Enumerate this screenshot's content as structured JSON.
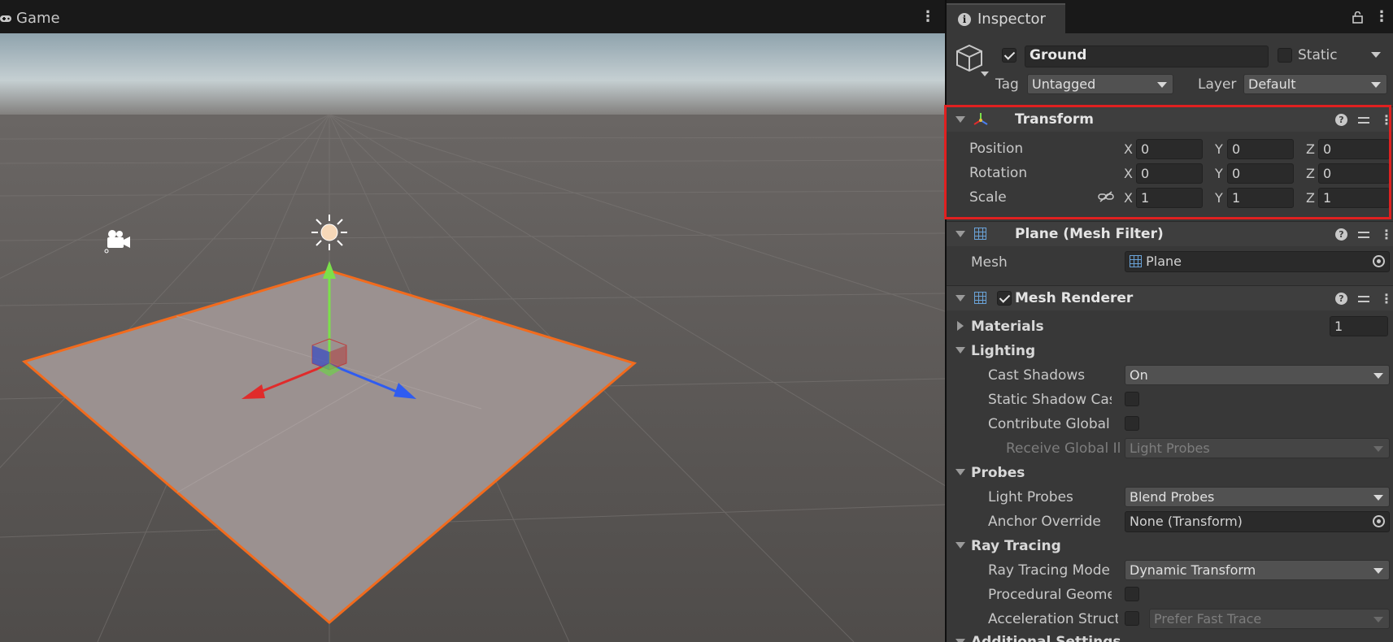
{
  "game": {
    "tab_label": "Game"
  },
  "inspector": {
    "tab_label": "Inspector",
    "object": {
      "active": true,
      "name": "Ground",
      "static_label": "Static",
      "static": false,
      "tag_label": "Tag",
      "tag_value": "Untagged",
      "layer_label": "Layer",
      "layer_value": "Default"
    },
    "transform": {
      "title": "Transform",
      "position_label": "Position",
      "rotation_label": "Rotation",
      "scale_label": "Scale",
      "position": {
        "x": "0",
        "y": "0",
        "z": "0"
      },
      "rotation": {
        "x": "0",
        "y": "0",
        "z": "0"
      },
      "scale": {
        "x": "1",
        "y": "1",
        "z": "1"
      },
      "axes": {
        "x": "X",
        "y": "Y",
        "z": "Z"
      }
    },
    "mesh_filter": {
      "title": "Plane (Mesh Filter)",
      "mesh_label": "Mesh",
      "mesh_value": "Plane"
    },
    "mesh_renderer": {
      "title": "Mesh Renderer",
      "enabled": true,
      "materials_label": "Materials",
      "materials_count": "1",
      "lighting_label": "Lighting",
      "cast_shadows_label": "Cast Shadows",
      "cast_shadows_value": "On",
      "static_shadow_caster_label": "Static Shadow Cast",
      "contribute_gi_label": "Contribute Global Ill",
      "receive_gi_label": "Receive Global Ill",
      "receive_gi_value": "Light Probes",
      "probes_label": "Probes",
      "light_probes_label": "Light Probes",
      "light_probes_value": "Blend Probes",
      "anchor_override_label": "Anchor Override",
      "anchor_override_value": "None (Transform)",
      "ray_tracing_label": "Ray Tracing",
      "ray_tracing_mode_label": "Ray Tracing Mode",
      "ray_tracing_mode_value": "Dynamic Transform",
      "procedural_geometry_label": "Procedural Geomet",
      "acceleration_structure_label": "Acceleration Structu",
      "acceleration_structure_value": "Prefer Fast Trace",
      "additional_settings_label": "Additional Settings"
    }
  },
  "colors": {
    "highlight": "#e02020",
    "selection_outline": "#f26b1d",
    "gizmo_x": "#e02b2b",
    "gizmo_y": "#7be04a",
    "gizmo_z": "#2f5cf0"
  }
}
